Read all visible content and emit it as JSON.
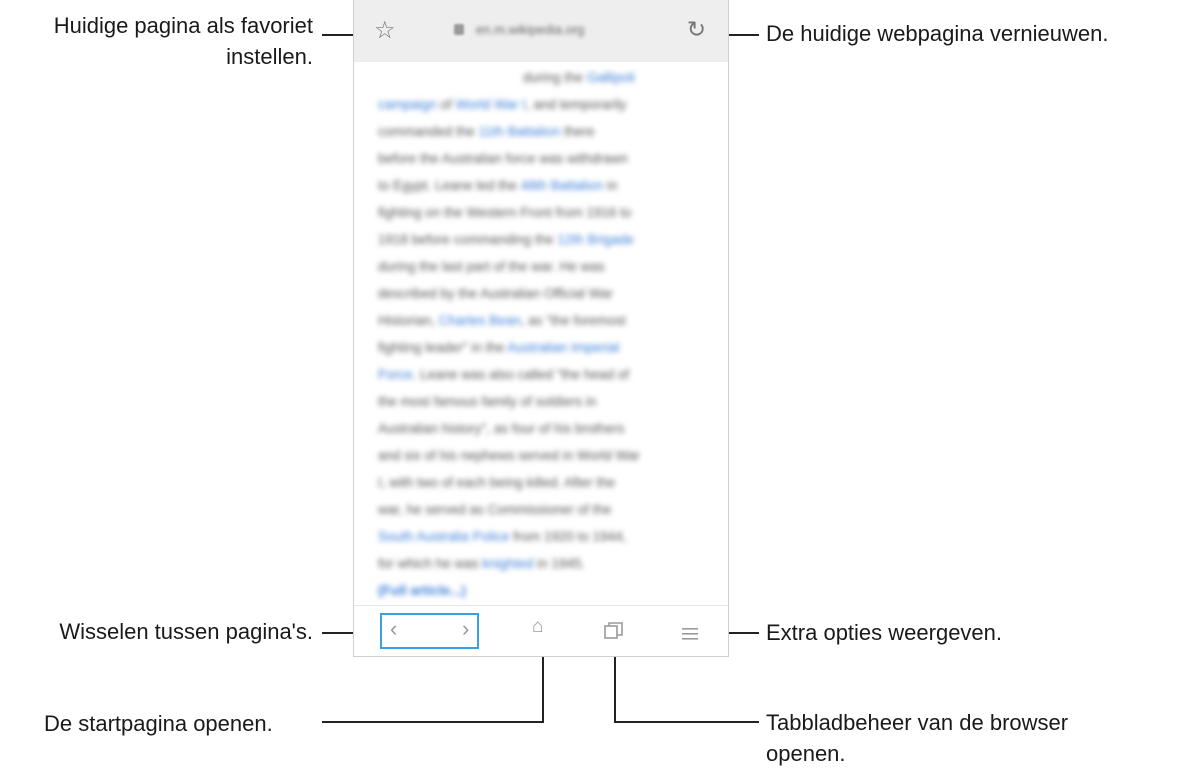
{
  "callouts": {
    "favorite": [
      "Huidige pagina als favoriet",
      "instellen."
    ],
    "reload": "De huidige webpagina vernieuwen.",
    "switch": "Wisselen tussen pagina's.",
    "more": "Extra opties weergeven.",
    "home": "De startpagina openen.",
    "tabs": [
      "Tabbladbeheer van de browser",
      "openen."
    ]
  },
  "url": "en.m.wikipedia.org",
  "icons": {
    "favorite": "star-icon",
    "reload": "reload-icon",
    "back": "chevron-left-icon",
    "forward": "chevron-right-icon",
    "home": "home-icon",
    "tabs": "tabs-icon",
    "menu": "menu-icon"
  },
  "article_lines": [
    {
      "parts": [
        {
          "t": "during the "
        },
        {
          "t": "Gallipoli",
          "c": "link"
        }
      ]
    },
    {
      "parts": [
        {
          "t": "campaign",
          "c": "link"
        },
        {
          "t": " of "
        },
        {
          "t": "World War I",
          "c": "link"
        },
        {
          "t": ", and temporarily"
        }
      ]
    },
    {
      "parts": [
        {
          "t": "commanded the "
        },
        {
          "t": "11th Battalion",
          "c": "link"
        },
        {
          "t": " there"
        }
      ]
    },
    {
      "parts": [
        {
          "t": "before the Australian force was withdrawn"
        }
      ]
    },
    {
      "parts": [
        {
          "t": "to Egypt. Leane led the "
        },
        {
          "t": "48th Battalion",
          "c": "link"
        },
        {
          "t": " in"
        }
      ]
    },
    {
      "parts": [
        {
          "t": "fighting on the Western Front from 1916 to"
        }
      ]
    },
    {
      "parts": [
        {
          "t": "1918 before commanding the "
        },
        {
          "t": "12th Brigade",
          "c": "link"
        }
      ]
    },
    {
      "parts": [
        {
          "t": "during the last part of the war. He was"
        }
      ]
    },
    {
      "parts": [
        {
          "t": "described by the Australian Official War"
        }
      ]
    },
    {
      "parts": [
        {
          "t": "Historian, "
        },
        {
          "t": "Charles Bean",
          "c": "link"
        },
        {
          "t": ", as \"the foremost"
        }
      ]
    },
    {
      "parts": [
        {
          "t": "fighting leader\" in the "
        },
        {
          "t": "Australian Imperial",
          "c": "link"
        }
      ]
    },
    {
      "parts": [
        {
          "t": "Force",
          "c": "link"
        },
        {
          "t": ". Leane was also called \"the head of"
        }
      ]
    },
    {
      "parts": [
        {
          "t": "the most famous family of soldiers in"
        }
      ]
    },
    {
      "parts": [
        {
          "t": "Australian history\", as four of his brothers"
        }
      ]
    },
    {
      "parts": [
        {
          "t": "and six of his nephews served in World War"
        }
      ]
    },
    {
      "parts": [
        {
          "t": "I, with two of each being killed. After the"
        }
      ]
    },
    {
      "parts": [
        {
          "t": "war, he served as Commissioner of the"
        }
      ]
    },
    {
      "parts": [
        {
          "t": "South Australia Police",
          "c": "link"
        },
        {
          "t": " from 1920 to 1944,"
        }
      ]
    },
    {
      "parts": [
        {
          "t": "for which he was "
        },
        {
          "t": "knighted",
          "c": "link"
        },
        {
          "t": " in 1945."
        }
      ]
    },
    {
      "parts": [
        {
          "t": "(Full article...)",
          "c": "bold"
        }
      ]
    }
  ]
}
